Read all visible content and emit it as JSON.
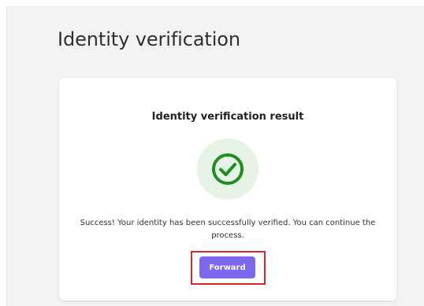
{
  "page": {
    "title": "Identity verification"
  },
  "card": {
    "title": "Identity verification result",
    "message": "Success! Your identity has been successfully verified. You can continue the process.",
    "status_icon": "check-circle-icon",
    "forward_label": "Forward"
  },
  "colors": {
    "success_green": "#1e8e1e",
    "success_bg": "#e6f3e6",
    "button_purple": "#7b68ee",
    "highlight_red": "#d9262b"
  }
}
